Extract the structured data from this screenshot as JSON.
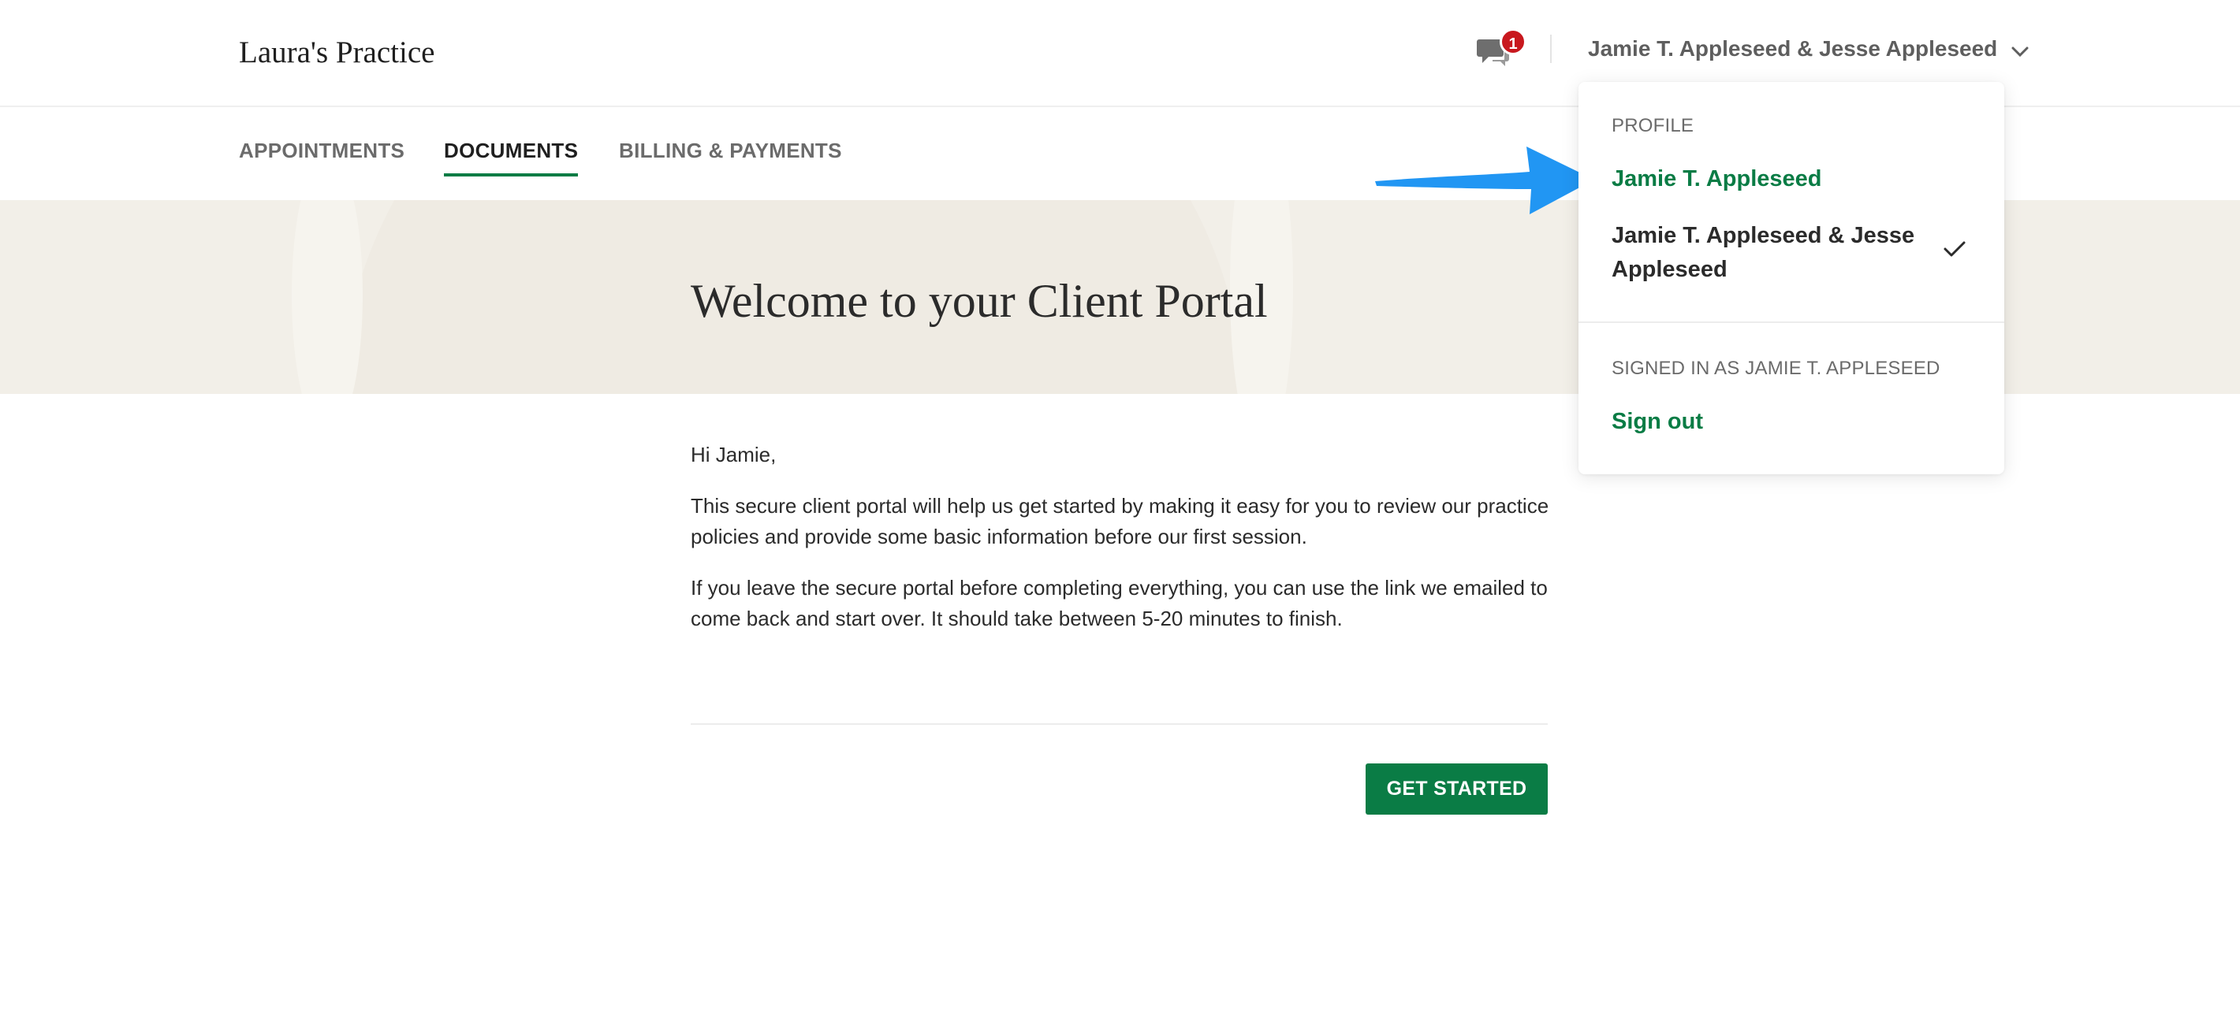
{
  "header": {
    "brand": "Laura's Practice",
    "messages_badge": "1",
    "account_name": "Jamie T. Appleseed & Jesse Appleseed"
  },
  "tabs": [
    {
      "label": "APPOINTMENTS",
      "active": false
    },
    {
      "label": "DOCUMENTS",
      "active": true
    },
    {
      "label": "BILLING & PAYMENTS",
      "active": false
    }
  ],
  "hero": {
    "title": "Welcome to your Client Portal"
  },
  "content": {
    "greeting": "Hi Jamie,",
    "paragraph_1": "This secure client portal will help us get started by making it easy for you to review our practice policies and provide some basic information before our first session.",
    "paragraph_2": "If you leave the secure portal before completing everything, you can use the link we emailed to come back and start over. It should take between 5-20 minutes to finish."
  },
  "cta": {
    "label": "GET STARTED"
  },
  "dropdown": {
    "profile_heading": "PROFILE",
    "profiles": [
      {
        "label": "Jamie T. Appleseed",
        "selected": false
      },
      {
        "label": "Jamie T. Appleseed & Jesse Appleseed",
        "selected": true
      }
    ],
    "signed_in_label": "SIGNED IN AS JAMIE T. APPLESEED",
    "sign_out_label": "Sign out"
  },
  "colors": {
    "accent_green": "#0a7c45",
    "badge_red": "#c8181e",
    "hero_bg": "#f2efe8",
    "annotation_arrow": "#2196f3"
  }
}
